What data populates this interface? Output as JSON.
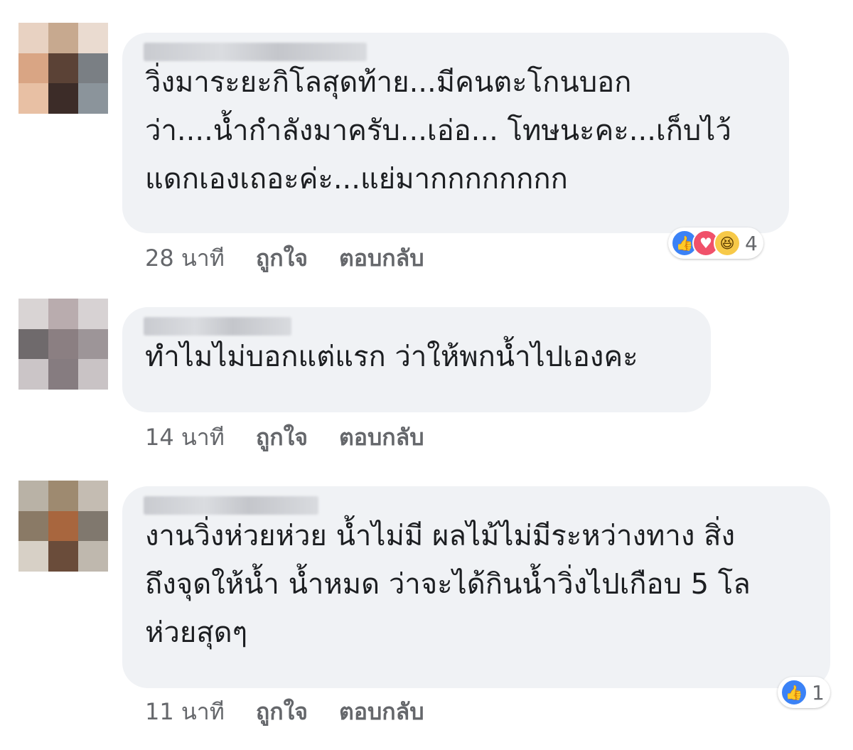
{
  "colors": {
    "bubble_bg": "#f0f2f5",
    "text": "#1c1e21",
    "meta": "#65676b",
    "like": "#3b82f6",
    "love": "#f0516a",
    "haha": "#f7c948"
  },
  "comments": [
    {
      "text": "วิ่งมาระยะกิโลสุดท้าย...มีคนตะโกนบอก\nว่า....น้ำกำลังมาครับ...เอ่อ... โทษนะคะ...เก็บไว้\nแดกเองเถอะค่ะ...แย่มากกกกกกกก",
      "time": "28 นาที",
      "like_label": "ถูกใจ",
      "reply_label": "ตอบกลับ",
      "reaction_icons": [
        "like-icon",
        "love-icon",
        "haha-icon"
      ],
      "reaction_count": "4"
    },
    {
      "text": "ทำไมไม่บอกแต่แรก ว่าให้พกน้ำไปเองคะ",
      "time": "14 นาที",
      "like_label": "ถูกใจ",
      "reply_label": "ตอบกลับ"
    },
    {
      "text": "งานวิ่งห่วยห่วย น้ำไม่มี ผลไม้ไม่มีระหว่างทาง สิ่ง\nถึงจุดให้น้ำ น้ำหมด ว่าจะได้กินน้ำวิ่งไปเกือบ 5 โล\nห่วยสุดๆ",
      "time": "11 นาที",
      "like_label": "ถูกใจ",
      "reply_label": "ตอบกลับ",
      "reaction_icons": [
        "like-icon"
      ],
      "reaction_count": "1"
    }
  ]
}
